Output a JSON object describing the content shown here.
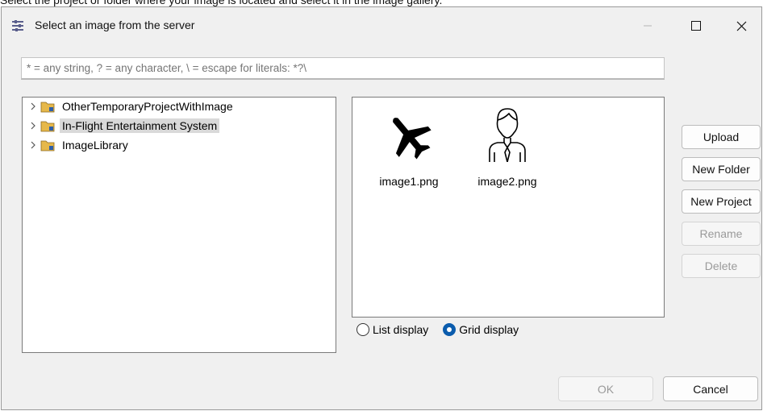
{
  "instruction": "Select the project or folder where your image is located and select it in the image gallery.",
  "window": {
    "title": "Select an image from the server",
    "icon": "dialog-settings-icon",
    "minimize": "minimize-icon",
    "maximize": "maximize-icon",
    "close": "close-icon"
  },
  "filter": {
    "placeholder": "* = any string, ? = any character, \\ = escape for literals: *?\\",
    "value": ""
  },
  "tree": {
    "items": [
      {
        "label": "OtherTemporaryProjectWithImage",
        "selected": false
      },
      {
        "label": "In-Flight Entertainment System",
        "selected": true
      },
      {
        "label": "ImageLibrary",
        "selected": false
      }
    ]
  },
  "gallery": {
    "items": [
      {
        "name": "image1.png",
        "icon": "airplane-icon"
      },
      {
        "name": "image2.png",
        "icon": "businessman-icon"
      }
    ]
  },
  "display": {
    "list_label": "List display",
    "grid_label": "Grid display",
    "selected": "grid"
  },
  "buttons": {
    "upload": "Upload",
    "new_folder": "New Folder",
    "new_project": "New Project",
    "rename": "Rename",
    "delete": "Delete",
    "ok": "OK",
    "cancel": "Cancel"
  },
  "colors": {
    "accent": "#0b5cad",
    "selection": "#d9d9d9",
    "folder": "#e6b84a"
  }
}
